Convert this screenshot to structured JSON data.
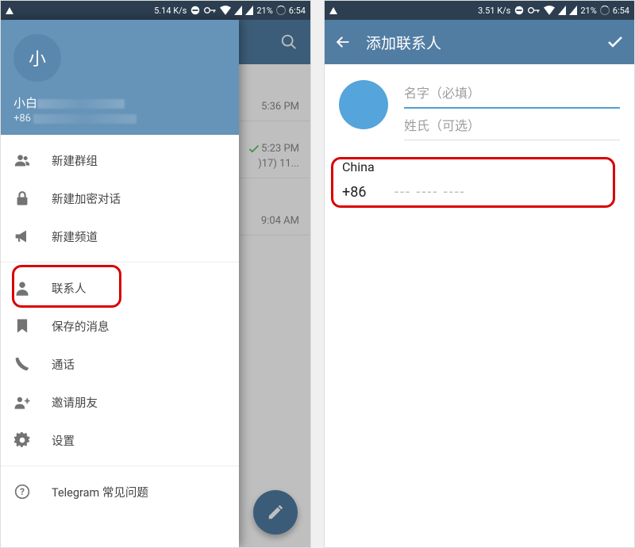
{
  "status": {
    "speed_left": "5.14 K/s",
    "speed_right": "3.51 K/s",
    "battery": "21%",
    "time": "6:54"
  },
  "left": {
    "drawer": {
      "avatar_initial": "小",
      "name": "小白",
      "phone_prefix": "+86",
      "items": [
        {
          "icon": "group",
          "label": "新建群组"
        },
        {
          "icon": "lock",
          "label": "新建加密对话"
        },
        {
          "icon": "megaphone",
          "label": "新建频道"
        },
        {
          "icon": "contact",
          "label": "联系人"
        },
        {
          "icon": "bookmark",
          "label": "保存的消息"
        },
        {
          "icon": "phone",
          "label": "通话"
        },
        {
          "icon": "adduser",
          "label": "邀请朋友"
        },
        {
          "icon": "gear",
          "label": "设置"
        },
        {
          "icon": "help",
          "label": "Telegram 常见问题"
        }
      ]
    },
    "chats": {
      "times": [
        "5:36 PM",
        "5:23 PM",
        "9:04 AM"
      ],
      "partial_text": ")17) 11..."
    }
  },
  "right": {
    "title": "添加联系人",
    "first_name_ph": "名字（必填）",
    "last_name_ph": "姓氏（可选）",
    "country": "China",
    "cc": "+86",
    "number_ph": "--- ---- ----"
  }
}
